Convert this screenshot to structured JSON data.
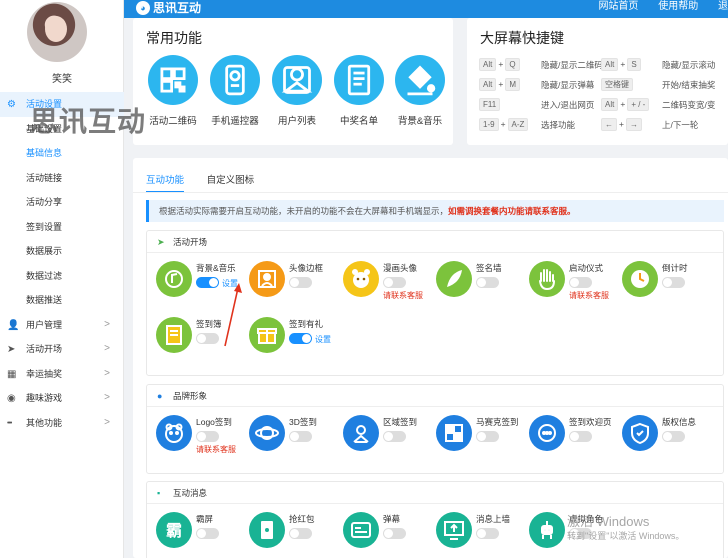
{
  "topbar": {
    "brand": "思讯互动",
    "nav": [
      "网站首页",
      "使用帮助",
      "退"
    ]
  },
  "sidebar": {
    "username": "笑笑",
    "watermark": "思讯互动",
    "items": [
      {
        "label": "活动设置",
        "icon": "gear-icon",
        "type": "parent",
        "arrow": ""
      },
      {
        "label": "基础设置",
        "type": "sub"
      },
      {
        "label": "基础信息",
        "type": "sub",
        "active": true
      },
      {
        "label": "活动链接",
        "type": "sub"
      },
      {
        "label": "活动分享",
        "type": "sub"
      },
      {
        "label": "签到设置",
        "type": "sub"
      },
      {
        "label": "数据展示",
        "type": "sub"
      },
      {
        "label": "数据过滤",
        "type": "sub"
      },
      {
        "label": "数据推送",
        "type": "sub"
      },
      {
        "label": "用户管理",
        "icon": "user-icon",
        "type": "group",
        "arrow": ">"
      },
      {
        "label": "活动开场",
        "icon": "send-icon",
        "type": "group",
        "arrow": ">"
      },
      {
        "label": "幸运抽奖",
        "icon": "grid-icon",
        "type": "group",
        "arrow": ">"
      },
      {
        "label": "趣味游戏",
        "icon": "gamepad-icon",
        "type": "group",
        "arrow": ">"
      },
      {
        "label": "其他功能",
        "icon": "more-icon",
        "type": "group",
        "arrow": ">"
      }
    ]
  },
  "common": {
    "title": "常用功能",
    "items": [
      {
        "label": "活动二维码",
        "icon": "qrcode-icon"
      },
      {
        "label": "手机遥控器",
        "icon": "remote-icon"
      },
      {
        "label": "用户列表",
        "icon": "user-list-icon"
      },
      {
        "label": "中奖名单",
        "icon": "winner-list-icon"
      },
      {
        "label": "背景&音乐",
        "icon": "paint-bucket-icon"
      }
    ]
  },
  "shortcuts": {
    "title": "大屏幕快捷键",
    "rows": [
      {
        "k1": [
          "Alt",
          "+",
          "Q"
        ],
        "d1": "隐藏/显示二维码",
        "k2": [
          "Alt",
          "+",
          "S"
        ],
        "d2": "隐藏/显示滚动"
      },
      {
        "k1": [
          "Alt",
          "+",
          "M"
        ],
        "d1": "隐藏/显示弹幕",
        "k2": [
          "空格键"
        ],
        "d2": "开始/结束抽奖"
      },
      {
        "k1": [
          "F11"
        ],
        "d1": "进入/退出网页",
        "k2": [
          "Alt",
          "+",
          "+ / -"
        ],
        "d2": "二维码变宽/变"
      },
      {
        "k1": [
          "1-9",
          "+",
          "A-Z"
        ],
        "d1": "选择功能",
        "k2": [
          "←",
          "+",
          "→"
        ],
        "d2": "上/下一轮"
      }
    ]
  },
  "main": {
    "tabs": [
      "互动功能",
      "自定义图标"
    ],
    "notice": {
      "text": "根据活动实际需要开启互动功能，未开启的功能不会在大屏幕和手机端显示，",
      "red": "如需调换套餐内功能请联系客服。"
    },
    "sections": [
      {
        "title": "活动开场",
        "icon": "send-icon",
        "features": [
          {
            "name": "背景&音乐",
            "on": true,
            "link": "设置",
            "color": "c-green",
            "icon": "music-icon"
          },
          {
            "name": "头像边框",
            "on": false,
            "color": "c-orange",
            "icon": "portrait-frame-icon"
          },
          {
            "name": "漫画头像",
            "on": false,
            "red": "请联系客服",
            "color": "c-yellow",
            "icon": "cartoon-face-icon"
          },
          {
            "name": "签名墙",
            "on": false,
            "color": "c-green",
            "icon": "feather-icon"
          },
          {
            "name": "启动仪式",
            "on": false,
            "red": "请联系客服",
            "color": "c-green",
            "icon": "hand-icon"
          },
          {
            "name": "倒计时",
            "on": false,
            "color": "c-green",
            "icon": "clock-icon"
          },
          {
            "name": "签到簿",
            "on": false,
            "color": "c-green",
            "icon": "book-icon"
          },
          {
            "name": "签到有礼",
            "on": true,
            "link": "设置",
            "color": "c-green",
            "icon": "gift-icon"
          }
        ]
      },
      {
        "title": "品牌形象",
        "icon": "badge-icon",
        "features": [
          {
            "name": "Logo签到",
            "on": false,
            "red": "请联系客服",
            "color": "c-blue",
            "icon": "face-icon"
          },
          {
            "name": "3D签到",
            "on": false,
            "color": "c-blue",
            "icon": "planet-icon"
          },
          {
            "name": "区域签到",
            "on": false,
            "color": "c-blue",
            "icon": "id-card-icon"
          },
          {
            "name": "马赛克签到",
            "on": false,
            "color": "c-blue",
            "icon": "mosaic-icon"
          },
          {
            "name": "签到欢迎页",
            "on": false,
            "color": "c-blue",
            "icon": "chat-bubble-icon"
          },
          {
            "name": "版权信息",
            "on": false,
            "color": "c-blue",
            "icon": "shield-icon"
          }
        ]
      },
      {
        "title": "互动消息",
        "icon": "message-icon",
        "features": [
          {
            "name": "霸屏",
            "on": false,
            "color": "c-teal",
            "icon": "ba-icon"
          },
          {
            "name": "抢红包",
            "on": false,
            "color": "c-teal",
            "icon": "red-packet-icon"
          },
          {
            "name": "弹幕",
            "on": false,
            "color": "c-teal",
            "icon": "barrage-icon"
          },
          {
            "name": "消息上墙",
            "on": false,
            "color": "c-teal",
            "icon": "screen-upload-icon"
          },
          {
            "name": "虚拟角色",
            "on": false,
            "color": "c-teal",
            "icon": "robot-icon"
          }
        ]
      }
    ]
  },
  "windows_watermark": {
    "line1": "激活 Windows",
    "line2": "转到\"设置\"以激活 Windows。"
  }
}
